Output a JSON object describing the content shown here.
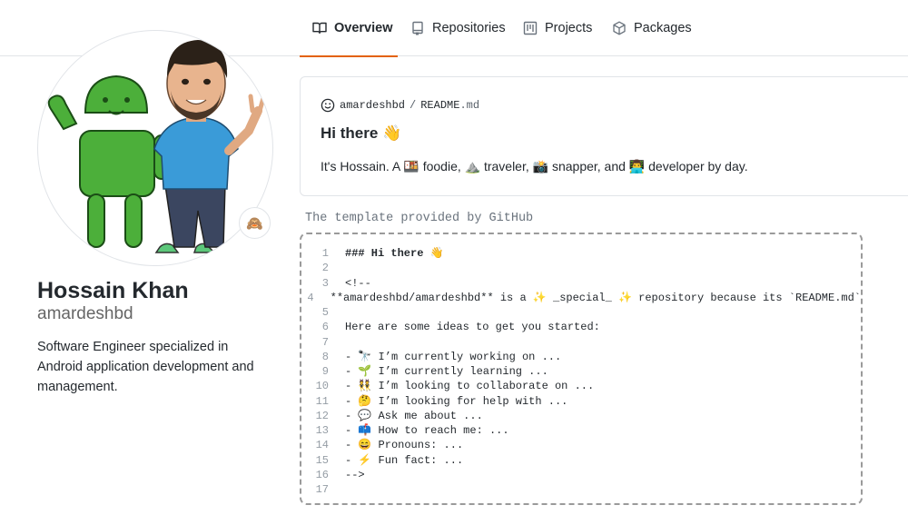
{
  "nav": {
    "tabs": [
      {
        "label": "Overview",
        "icon": "book-icon"
      },
      {
        "label": "Repositories",
        "icon": "repo-icon"
      },
      {
        "label": "Projects",
        "icon": "project-icon"
      },
      {
        "label": "Packages",
        "icon": "package-icon"
      }
    ],
    "accent": "#e36209"
  },
  "profile": {
    "name": "Hossain Khan",
    "login": "amardeshbd",
    "bio": "Software Engineer specialized in Android application development and management.",
    "status_emoji": "🙈"
  },
  "readme": {
    "owner": "amardeshbd",
    "separator": "/",
    "file": "README",
    "ext": ".md",
    "title": "Hi there 👋",
    "text": "It's Hossain. A 🍱 foodie, ⛰️ traveler, 📸 snapper, and 👨‍💻 developer by day."
  },
  "caption": "The template provided by GitHub",
  "code_lines": [
    {
      "n": "1",
      "text": "### Hi there 👋"
    },
    {
      "n": "2",
      "text": ""
    },
    {
      "n": "3",
      "text": "<!--"
    },
    {
      "n": "4",
      "text": "**amardeshbd/amardeshbd** is a ✨ _special_ ✨ repository because its `README.md`"
    },
    {
      "n": "5",
      "text": ""
    },
    {
      "n": "6",
      "text": "Here are some ideas to get you started:"
    },
    {
      "n": "7",
      "text": ""
    },
    {
      "n": "8",
      "text": "- 🔭 I’m currently working on ..."
    },
    {
      "n": "9",
      "text": "- 🌱 I’m currently learning ..."
    },
    {
      "n": "10",
      "text": "- 👯 I’m looking to collaborate on ..."
    },
    {
      "n": "11",
      "text": "- 🤔 I’m looking for help with ..."
    },
    {
      "n": "12",
      "text": "- 💬 Ask me about ..."
    },
    {
      "n": "13",
      "text": "- 📫 How to reach me: ..."
    },
    {
      "n": "14",
      "text": "- 😄 Pronouns: ..."
    },
    {
      "n": "15",
      "text": "- ⚡ Fun fact: ..."
    },
    {
      "n": "16",
      "text": "-->"
    },
    {
      "n": "17",
      "text": ""
    }
  ]
}
